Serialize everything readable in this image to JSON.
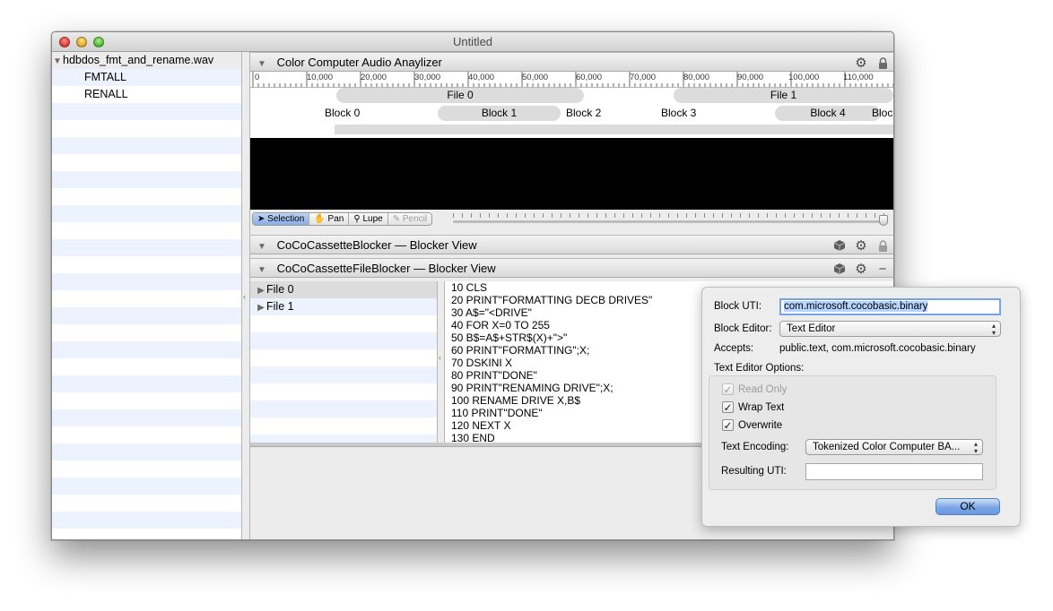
{
  "window": {
    "title": "Untitled"
  },
  "sidebar": {
    "root": "hdbdos_fmt_and_rename.wav",
    "items": [
      "FMTALL",
      "RENALL"
    ]
  },
  "analyzer": {
    "title": "Color Computer Audio Anaylizer",
    "ruler_labels": [
      "0",
      "10,000",
      "20,000",
      "30,000",
      "40,000",
      "50,000",
      "60,000",
      "70,000",
      "80,000",
      "90,000",
      "100,000",
      "110,000"
    ],
    "files": [
      "File 0",
      "File 1"
    ],
    "blocks": [
      "Block 0",
      "Block 1",
      "Block 2",
      "Block 3",
      "Block 4",
      "Bloc"
    ],
    "tools": [
      "Selection",
      "Pan",
      "Lupe",
      "Pencil"
    ]
  },
  "blocker_view": {
    "title": "CoCoCassetteBlocker — Blocker View"
  },
  "file_blocker_view": {
    "title": "CoCoCassetteFileBlocker — Blocker View",
    "files": [
      "File 0",
      "File 1"
    ],
    "code": [
      "10 CLS",
      "20 PRINT\"FORMATTING DECB DRIVES\"",
      "30 A$=\"<DRIVE\"",
      "40 FOR X=0 TO 255",
      "50 B$=A$+STR$(X)+\">\"",
      "60 PRINT\"FORMATTING\";X;",
      "70 DSKINI X",
      "80 PRINT\"DONE\"",
      "90 PRINT\"RENAMING DRIVE\";X;",
      "100 RENAME DRIVE X,B$",
      "110 PRINT\"DONE\"",
      "120 NEXT X",
      "130 END"
    ]
  },
  "popover": {
    "block_uti_label": "Block UTI:",
    "block_uti_value": "com.microsoft.cocobasic.binary",
    "block_editor_label": "Block Editor:",
    "block_editor_value": "Text Editor",
    "accepts_label": "Accepts:",
    "accepts_value": "public.text, com.microsoft.cocobasic.binary",
    "options_label": "Text Editor Options:",
    "read_only_label": "Read Only",
    "read_only_checked": true,
    "wrap_text_label": "Wrap Text",
    "wrap_text_checked": true,
    "overwrite_label": "Overwrite",
    "overwrite_checked": true,
    "text_encoding_label": "Text Encoding:",
    "text_encoding_value": "Tokenized Color Computer BA...",
    "resulting_uti_label": "Resulting UTI:",
    "resulting_uti_value": "",
    "ok_label": "OK"
  }
}
